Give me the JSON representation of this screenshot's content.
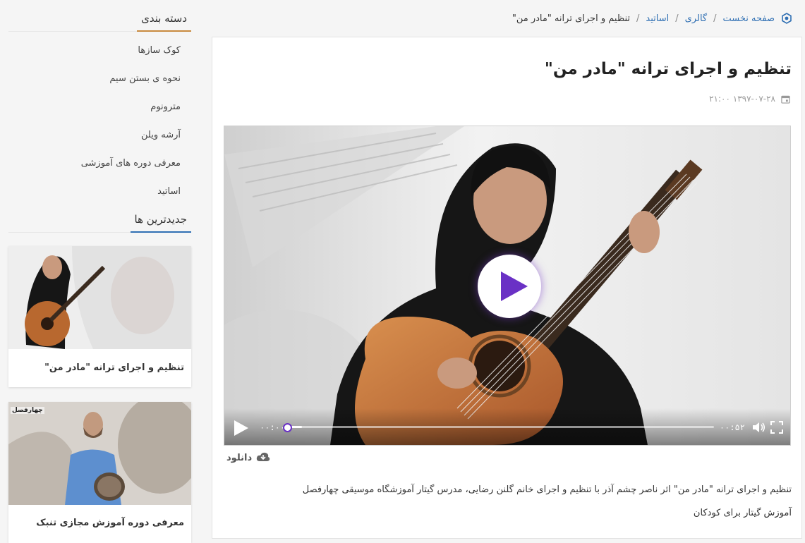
{
  "breadcrumb": {
    "items": [
      "صفحه نخست",
      "گالری",
      "اساتید"
    ],
    "current": "تنظیم و اجرای ترانه \"مادر من\""
  },
  "post": {
    "title": "تنظیم و اجرای ترانه \"مادر من\"",
    "date": "۱۳۹۷-۰۷-۲۸ ۲۱:۰۰",
    "download_label": "دانلود",
    "description": "تنظیم و اجرای ترانه \"مادر من\" اثر ناصر چشم آذر با تنظیم و اجرای خانم گلنن رضایی، مدرس گیتار آموزشگاه موسیقی چهارفصل",
    "tag_line": "آموزش گیتار برای کودکان"
  },
  "player": {
    "current_time": "۰۰:۰۰",
    "duration": "۰۰:۵۲",
    "progress": 0,
    "buffered": 0.04,
    "accent_color": "#6a31c5"
  },
  "sidebar": {
    "categories_title": "دسته بندی",
    "categories_accent": "#c98a3e",
    "categories": [
      "کوک سازها",
      "نحوه ی بستن سیم",
      "مترونوم",
      "آرشه ویلن",
      "معرفی دوره های آموزشی",
      "اساتید"
    ],
    "latest_title": "جدیدترین ها",
    "latest_accent": "#2f6fb3",
    "latest_posts": [
      {
        "caption": "تنظیم و اجرای ترانه \"مادر من\""
      },
      {
        "caption": "معرفی دوره آموزش مجازی تنبک",
        "logo_text": "چهارفصل"
      }
    ]
  }
}
